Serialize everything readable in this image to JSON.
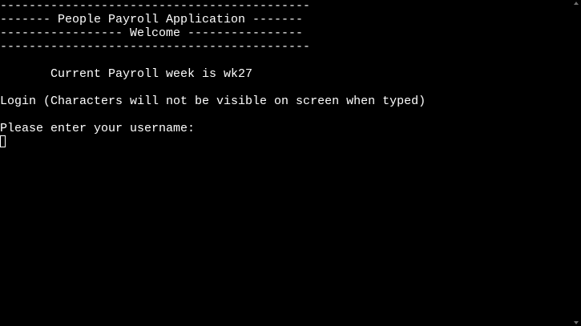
{
  "terminal": {
    "lines": [
      "-------------------------------------------",
      "------- People Payroll Application -------",
      "----------------- Welcome ----------------",
      "-------------------------------------------",
      "",
      "       Current Payroll week is wk27",
      "",
      "Login (Characters will not be visible on screen when typed)",
      "",
      "Please enter your username:"
    ],
    "input_value": ""
  },
  "colors": {
    "background": "#000000",
    "text": "#ffffff"
  }
}
